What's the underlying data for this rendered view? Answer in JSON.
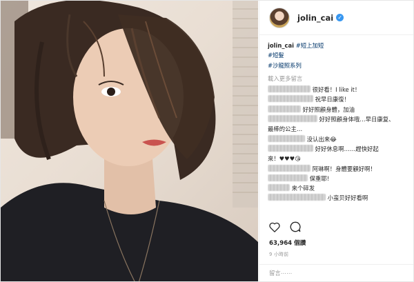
{
  "header": {
    "username": "jolin_cai",
    "verified": true,
    "verified_icon": "verified-badge-icon"
  },
  "caption": {
    "user": "jolin_cai",
    "hashtags": [
      "#短上加短",
      "#短髮",
      "#沙龍照系列"
    ]
  },
  "load_more": "載入更多留言",
  "comments": [
    {
      "text": "很好看！I like it！"
    },
    {
      "text": "祝早日康復！"
    },
    {
      "text": "好好照顧身體，加油"
    },
    {
      "text": "好好照顧身体哦…早日康复、"
    },
    {
      "text": "最棒的公主…"
    },
    {
      "text": "没认出来😂"
    },
    {
      "text": "好好休息啊……趕快好起"
    },
    {
      "text": "來！♥♥♥😘"
    },
    {
      "text": "阿琳啊！身體要顧好啊！"
    },
    {
      "text": "保重耶!"
    },
    {
      "text": "来个碎发"
    },
    {
      "text": "小蛮贝好好看啊"
    }
  ],
  "actions": {
    "like_icon": "heart-outline-icon",
    "comment_icon": "speech-bubble-icon"
  },
  "likes": "63,964 個讚",
  "time_ago": "9 小時前",
  "add_comment_placeholder": "留言⋯⋯",
  "colors": {
    "link": "#003569",
    "verified": "#3897f0",
    "muted": "#999999"
  }
}
